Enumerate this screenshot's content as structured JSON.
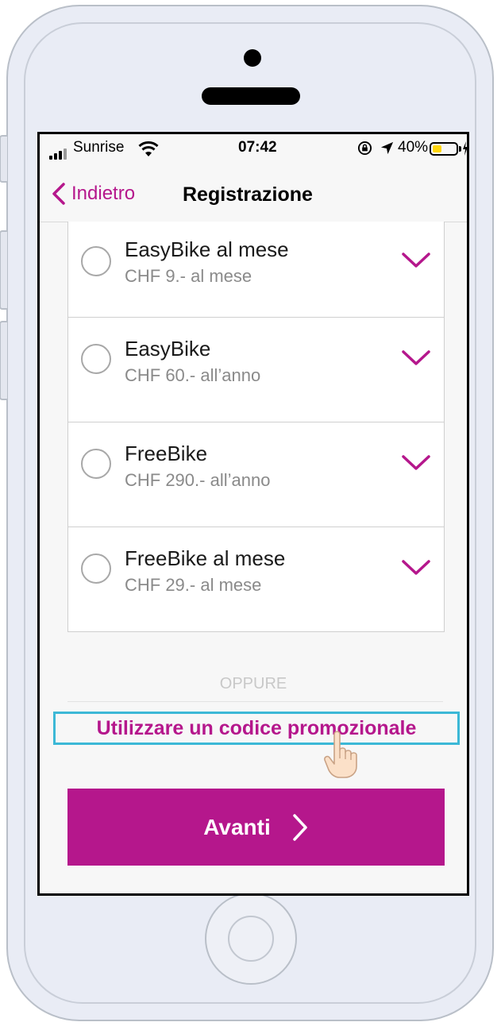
{
  "status_bar": {
    "carrier": "Sunrise",
    "time": "07:42",
    "battery_percent": "40%",
    "battery_level": 0.4,
    "icons": [
      "signal-icon",
      "wifi-icon",
      "rotation-lock-icon",
      "location-icon",
      "battery-icon",
      "charging-icon"
    ]
  },
  "nav": {
    "back_label": "Indietro",
    "title": "Registrazione"
  },
  "plans": [
    {
      "name": "EasyBike al mese",
      "price": "CHF 9.- al mese"
    },
    {
      "name": "EasyBike",
      "price": "CHF 60.- all’anno"
    },
    {
      "name": "FreeBike",
      "price": "CHF 290.- all’anno"
    },
    {
      "name": "FreeBike al mese",
      "price": "CHF 29.- al mese"
    }
  ],
  "separator_text": "OPPURE",
  "promo_link": "Utilizzare un codice promozionale",
  "next_button": "Avanti",
  "colors": {
    "accent": "#b5178c",
    "highlight": "#3cb8d6",
    "battery": "#ffd60a"
  }
}
